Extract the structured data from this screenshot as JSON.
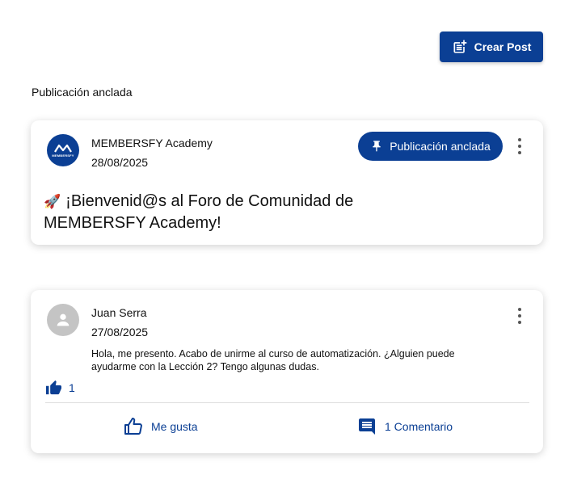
{
  "header": {
    "create_post_label": "Crear Post"
  },
  "pinned_section": {
    "title": "Publicación anclada"
  },
  "pinned_post": {
    "author": "MEMBERSFY Academy",
    "date": "28/08/2025",
    "badge_label": "Publicación anclada",
    "title": "¡Bienvenid@s al Foro de Comunidad de MEMBERSFY Academy!",
    "title_emoji": "🚀",
    "avatar_text": "MEMBERSFY"
  },
  "post": {
    "author": "Juan Serra",
    "date": "27/08/2025",
    "body": "Hola, me presento. Acabo de unirme al curso de automatización. ¿Alguien puede ayudarme con la Lección 2? Tengo algunas dudas.",
    "like_count": "1",
    "like_action_label": "Me gusta",
    "comment_action_label": "1 Comentario"
  },
  "colors": {
    "primary": "#0b3f94",
    "avatar_placeholder": "#c4c4c4"
  }
}
